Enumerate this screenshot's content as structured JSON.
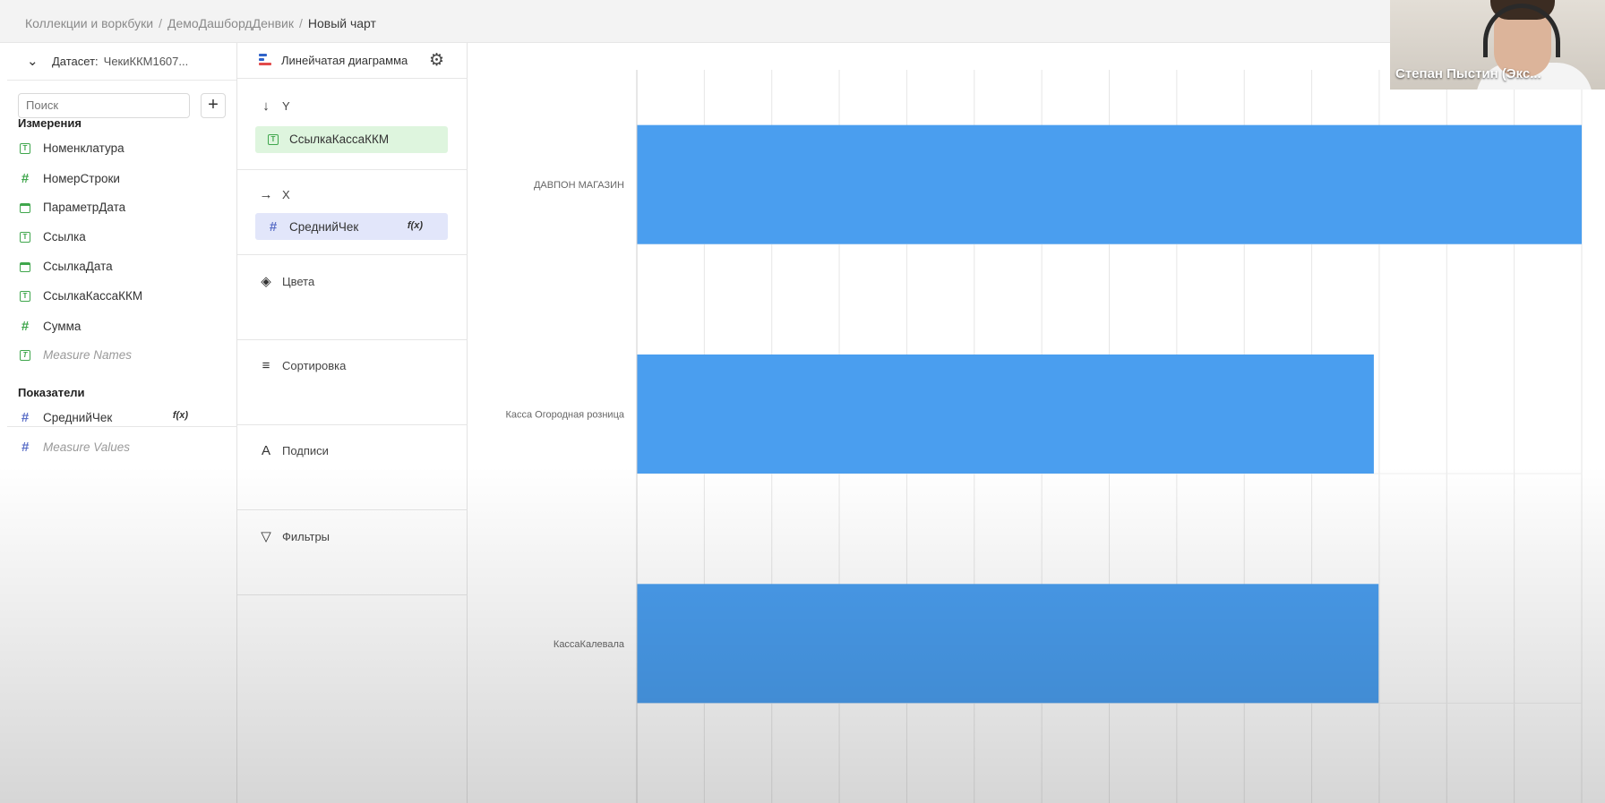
{
  "breadcrumbs": [
    "Коллекции и воркбуки",
    "ДемоДашбордДенвик",
    "Новый чарт"
  ],
  "breadcrumb_separator": "/",
  "dataset": {
    "label": "Датасет:",
    "name": "ЧекиККМ1607..."
  },
  "search": {
    "placeholder": "Поиск",
    "value": ""
  },
  "add_button_label": "+",
  "dimensions_title": "Измерения",
  "dimensions": [
    {
      "label": "Номенклатура",
      "icon": "text-type-icon"
    },
    {
      "label": "НомерСтроки",
      "icon": "number-type-icon"
    },
    {
      "label": "ПараметрДата",
      "icon": "date-type-icon"
    },
    {
      "label": "Ссылка",
      "icon": "text-type-icon"
    },
    {
      "label": "СсылкаДата",
      "icon": "date-type-icon"
    },
    {
      "label": "СсылкаКассаККМ",
      "icon": "text-type-icon"
    },
    {
      "label": "Сумма",
      "icon": "number-type-icon"
    },
    {
      "label": "Measure Names",
      "icon": "text-type-icon"
    }
  ],
  "measures_title": "Показатели",
  "measures": [
    {
      "label": "СреднийЧек",
      "icon": "number-type-icon",
      "formula_badge": "f(x)"
    },
    {
      "label": "Measure Values",
      "icon": "number-type-icon"
    }
  ],
  "visualization": {
    "type_label": "Линейчатая диаграмма",
    "sections": {
      "y": {
        "title": "Y",
        "field": "СсылкаКассаККМ"
      },
      "x": {
        "title": "X",
        "field": "СреднийЧек",
        "formula_badge": "f(x)"
      },
      "colors": {
        "title": "Цвета"
      },
      "sort": {
        "title": "Сортировка"
      },
      "labels": {
        "title": "Подписи"
      },
      "filters": {
        "title": "Фильтры"
      }
    }
  },
  "webcam": {
    "name": "Степан Пыстин (Экс..."
  },
  "colors": {
    "bar": "#4a9eef",
    "field_green": "#def5de",
    "field_blue": "#e2e6fa",
    "grid": "#e6e6e6"
  },
  "chart_data": {
    "type": "bar",
    "orientation": "horizontal",
    "categories": [
      "ДАВПОН МАГАЗИН",
      "Касса Огородная розница",
      "КассаКалевала"
    ],
    "values": [
      100,
      78,
      78.5
    ],
    "xlim": [
      0,
      100
    ],
    "grid": true,
    "x_tick_labels_visible": false,
    "title": "",
    "xlabel": "",
    "ylabel": ""
  }
}
